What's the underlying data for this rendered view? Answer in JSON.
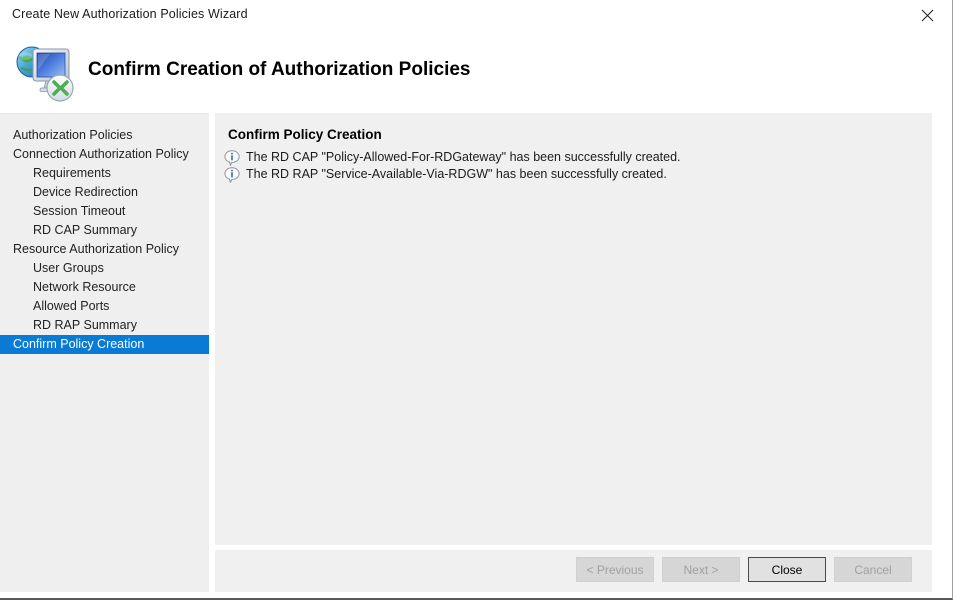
{
  "window": {
    "title": "Create New Authorization Policies Wizard",
    "close_icon": "close-icon"
  },
  "header": {
    "icon": "rd-gateway-icon",
    "title": "Confirm Creation of Authorization Policies"
  },
  "sidebar": {
    "items": [
      {
        "label": "Authorization Policies",
        "level": 1,
        "selected": false
      },
      {
        "label": "Connection Authorization Policy",
        "level": 1,
        "selected": false
      },
      {
        "label": "Requirements",
        "level": 2,
        "selected": false
      },
      {
        "label": "Device Redirection",
        "level": 2,
        "selected": false
      },
      {
        "label": "Session Timeout",
        "level": 2,
        "selected": false
      },
      {
        "label": "RD CAP Summary",
        "level": 2,
        "selected": false
      },
      {
        "label": "Resource Authorization Policy",
        "level": 1,
        "selected": false
      },
      {
        "label": "User Groups",
        "level": 2,
        "selected": false
      },
      {
        "label": "Network Resource",
        "level": 2,
        "selected": false
      },
      {
        "label": "Allowed Ports",
        "level": 2,
        "selected": false
      },
      {
        "label": "RD RAP Summary",
        "level": 2,
        "selected": false
      },
      {
        "label": "Confirm Policy Creation",
        "level": 1,
        "selected": true
      }
    ],
    "selected_color": "#0a7bd4"
  },
  "main": {
    "heading": "Confirm Policy Creation",
    "messages": [
      {
        "icon": "info-icon",
        "text": "The RD CAP \"Policy-Allowed-For-RDGateway\" has been successfully created."
      },
      {
        "icon": "info-icon",
        "text": "The RD RAP \"Service-Available-Via-RDGW\" has been successfully created."
      }
    ]
  },
  "footer": {
    "buttons": [
      {
        "label": "< Previous",
        "state": "disabled"
      },
      {
        "label": "Next >",
        "state": "disabled"
      },
      {
        "label": "Close",
        "state": "default"
      },
      {
        "label": "Cancel",
        "state": "disabled"
      }
    ]
  }
}
